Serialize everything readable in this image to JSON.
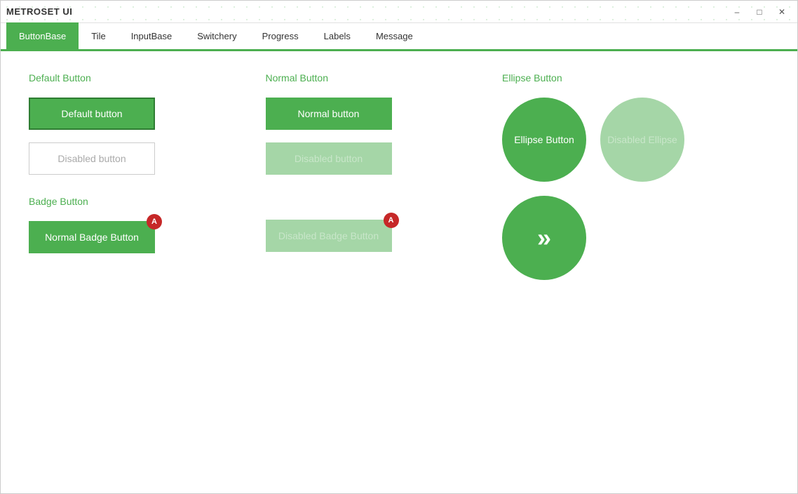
{
  "titleBar": {
    "title": "METROSET UI",
    "minimizeLabel": "–",
    "maximizeLabel": "□",
    "closeLabel": "✕"
  },
  "nav": {
    "tabs": [
      {
        "id": "buttonbase",
        "label": "ButtonBase",
        "active": true
      },
      {
        "id": "tile",
        "label": "Tile",
        "active": false
      },
      {
        "id": "inputbase",
        "label": "InputBase",
        "active": false
      },
      {
        "id": "switchery",
        "label": "Switchery",
        "active": false
      },
      {
        "id": "progress",
        "label": "Progress",
        "active": false
      },
      {
        "id": "labels",
        "label": "Labels",
        "active": false
      },
      {
        "id": "message",
        "label": "Message",
        "active": false
      }
    ]
  },
  "defaultButton": {
    "sectionTitle": "Default Button",
    "normalLabel": "Default button",
    "disabledLabel": "Disabled button"
  },
  "normalButton": {
    "sectionTitle": "Normal Button",
    "normalLabel": "Normal button",
    "disabledLabel": "Disabled button"
  },
  "badgeButton": {
    "sectionTitle": "Badge Button",
    "normalLabel": "Normal Badge Button",
    "disabledLabel": "Disabled Badge Button",
    "badgeLabel": "A"
  },
  "ellipseButton": {
    "sectionTitle": "Ellipse Button",
    "normalLabel": "Ellipse Button",
    "disabledLabel": "Disabled Ellipse",
    "arrowSymbol": "»"
  }
}
